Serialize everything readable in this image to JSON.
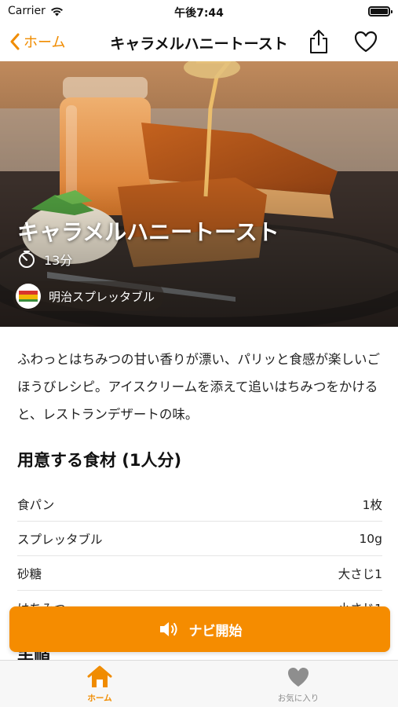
{
  "status_bar": {
    "carrier": "Carrier",
    "time": "午後7:44"
  },
  "nav": {
    "back_label": "ホーム",
    "title": "キャラメルハニートースト"
  },
  "hero": {
    "title": "キャラメルハニートースト",
    "time": "13分",
    "brand": "明治スプレッタブル"
  },
  "description": "ふわっとはちみつの甘い香りが漂い、パリッと食感が楽しいごほうびレシピ。アイスクリームを添えて追いはちみつをかけると、レストランデザートの味。",
  "ingredients": {
    "title": "用意する食材 (1人分)",
    "items": [
      {
        "name": "食パン",
        "amount": "1枚"
      },
      {
        "name": "スプレッタブル",
        "amount": "10g"
      },
      {
        "name": "砂糖",
        "amount": "大さじ1"
      },
      {
        "name": "はちみつ",
        "amount": "小さじ1"
      }
    ]
  },
  "steps": {
    "title": "手順"
  },
  "navi_button": {
    "label": "ナビ開始"
  },
  "tab_bar": {
    "home_label": "ホーム",
    "favorites_label": "お気に入り"
  },
  "colors": {
    "accent": "#f58c00",
    "tab_inactive": "#8e8e8e"
  },
  "icons": [
    "wifi-icon",
    "battery-icon",
    "chevron-left-icon",
    "share-icon",
    "heart-outline-icon",
    "timer-icon",
    "speaker-icon",
    "home-icon",
    "heart-filled-icon"
  ]
}
